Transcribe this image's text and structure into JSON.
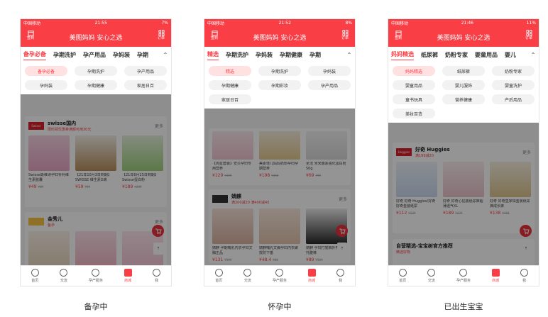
{
  "header_title": "美图妈妈 安心之选",
  "header_left_label": "签到",
  "header_right_label": "订单",
  "nav": [
    "首页",
    "交流",
    "孕产服务",
    "商城",
    "我"
  ],
  "colors": {
    "brand": "#fa3e46",
    "price": "#fa3e46"
  },
  "phones": [
    {
      "status_left": "中国移动",
      "status_time": "21:55",
      "status_right": "7%",
      "tabs": [
        "备孕必备",
        "孕期洗护",
        "孕产用品",
        "孕妈装",
        "孕期"
      ],
      "chips": [
        "备孕必备",
        "孕期洗护",
        "孕产用品",
        "孕妈装",
        "孕期健康",
        "家居日百"
      ],
      "shop": {
        "logo": "Swisse",
        "name": "swisse国内",
        "sub": "限时领优惠券满额可用30元",
        "more": "更多"
      },
      "products": [
        {
          "name": "Swisse斯维诗孕妇补钙维生素胶囊",
          "price": "¥49",
          "orig": "¥89"
        },
        {
          "name": "【21年10月3日到期】SWISSE 维生素D滴",
          "price": "¥59",
          "orig": "¥69"
        },
        {
          "name": "【21年6月25日到期】Swisse蛋白粉",
          "price": "¥189",
          "orig": "¥249"
        }
      ],
      "shop2": {
        "name": "金秀儿",
        "sub": "备孕",
        "more": "更多"
      },
      "caption": "备孕中"
    },
    {
      "status_left": "中国移动",
      "status_time": "21:52",
      "status_right": "8%",
      "tabs": [
        "精选",
        "孕期洗护",
        "孕妈装",
        "孕期健康",
        "孕期"
      ],
      "chips": [
        "精选",
        "孕期洗护",
        "孕妈装",
        "孕期健康",
        "孕期彩妆",
        "孕产用品",
        "家居日百"
      ],
      "products": [
        {
          "name": "【周星套装】安贝孕妇专用营养",
          "price": "¥129",
          "orig": "¥199"
        },
        {
          "name": "美素佳儿妈妈奶粉孕妇孕期营养",
          "price": "¥198",
          "orig": "¥258"
        },
        {
          "name": "圣洁 米米酵素强化蛋白粉 50g",
          "price": "¥69",
          "orig": "¥99"
        }
      ],
      "shop2": {
        "name": "婧麒",
        "sub": "满200减20 满400减40",
        "more": "更多"
      },
      "products2": [
        {
          "name": "婧麒 孕期哺乳内衣孕妇文胸正品",
          "price": "¥131",
          "orig": "¥199"
        },
        {
          "name": "婧麒哺乳文胸孕妇内衣聚拢防下垂",
          "price": "¥48.4",
          "orig": "¥88"
        },
        {
          "name": "婧麒 孕妇打底裤外穿春秋托腹裤",
          "price": "¥89",
          "orig": "¥129"
        }
      ],
      "caption": "怀孕中"
    },
    {
      "status_left": "中国移动",
      "status_time": "21:46",
      "status_right": "11%",
      "tabs": [
        "妈妈精选",
        "纸尿裤",
        "奶粉专家",
        "婴童用品",
        "婴儿"
      ],
      "chips": [
        "妈妈精选",
        "纸尿裤",
        "奶粉专家",
        "婴童用品",
        "婴儿服饰",
        "婴童洗护",
        "童书玩具",
        "营养健康",
        "产后用品",
        "美妆百货"
      ],
      "shop": {
        "logo": "Huggies",
        "name": "好奇 Huggies",
        "sub": "满199减20",
        "more": "更多"
      },
      "products": [
        {
          "name": "好奇 好奇 Huggies/好奇 好奇金装纸尿",
          "price": "¥112",
          "orig": "¥139"
        },
        {
          "name": "好奇 好奇心钻装纸尿裤超薄透气XL",
          "price": "¥189",
          "orig": "¥239"
        },
        {
          "name": "好奇 好奇皇家铂金装纸尿裤成长裤",
          "price": "¥138",
          "orig": "¥168"
        }
      ],
      "shop2": {
        "name": "自营精选-宝宝树官方推荐",
        "sub": "精选好物",
        "more": ""
      },
      "caption": "已出生宝宝"
    }
  ]
}
